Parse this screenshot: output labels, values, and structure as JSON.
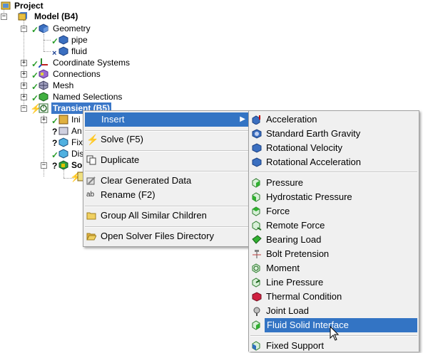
{
  "tree": {
    "project": "Project",
    "model": "Model (B4)",
    "geometry": "Geometry",
    "pipe": "pipe",
    "fluid": "fluid",
    "coordinate_systems": "Coordinate Systems",
    "connections": "Connections",
    "mesh": "Mesh",
    "named_selections": "Named Selections",
    "transient": "Transient (B5)",
    "child_ini": "Ini",
    "child_an": "An",
    "child_fix": "Fix",
    "child_dis": "Dis",
    "child_so": "So"
  },
  "context_menu": {
    "items": [
      {
        "label": "Insert"
      },
      {
        "label": "Solve (F5)"
      },
      {
        "label": "Duplicate"
      },
      {
        "label": "Clear Generated Data"
      },
      {
        "label": "Rename (F2)"
      },
      {
        "label": "Group All Similar Children"
      },
      {
        "label": "Open Solver Files Directory"
      }
    ]
  },
  "insert_submenu": {
    "items": [
      {
        "label": "Acceleration"
      },
      {
        "label": "Standard Earth Gravity"
      },
      {
        "label": "Rotational Velocity"
      },
      {
        "label": "Rotational Acceleration"
      },
      {
        "label": "Pressure"
      },
      {
        "label": "Hydrostatic Pressure"
      },
      {
        "label": "Force"
      },
      {
        "label": "Remote Force"
      },
      {
        "label": "Bearing Load"
      },
      {
        "label": "Bolt Pretension"
      },
      {
        "label": "Moment"
      },
      {
        "label": "Line Pressure"
      },
      {
        "label": "Thermal Condition"
      },
      {
        "label": "Joint Load"
      },
      {
        "label": "Fluid Solid Interface"
      },
      {
        "label": "Fixed Support"
      }
    ]
  },
  "colors": {
    "selection": "#3374c4",
    "tree_selection": "#3a77c8",
    "menu_bg": "#f0f0f0",
    "check_green": "#2a9d2a"
  }
}
